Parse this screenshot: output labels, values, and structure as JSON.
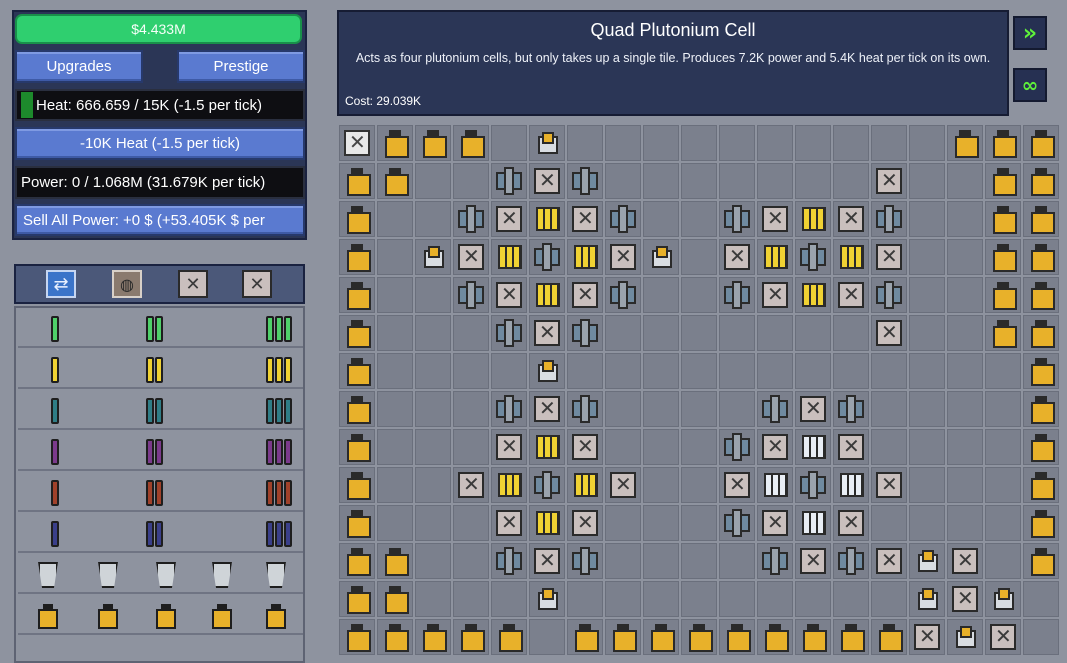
{
  "money": "$4.433M",
  "buttons": {
    "upgrades": "Upgrades",
    "prestige": "Prestige",
    "vent_heat": "-10K Heat (-1.5 per tick)",
    "sell_power": "Sell All Power: +0 $ (+53.405K $ per"
  },
  "heat": "Heat: 666.659 / 15K (-1.5 per tick)",
  "power": "Power: 0 / 1.068M (31.679K per tick)",
  "info": {
    "title": "Quad Plutonium Cell",
    "description": "Acts as four plutonium cells, but only takes up a single tile. Produces 7.2K power and 5.4K heat per tick on its own.",
    "cost": "Cost: 29.039K"
  },
  "part_tabs": [
    "power-tab-icon",
    "heat-tab-icon",
    "locked-tab-icon",
    "locked-tab-icon"
  ],
  "part_rows": [
    {
      "color": "#4fd06a",
      "kinds": [
        "single",
        "double",
        "quad"
      ]
    },
    {
      "color": "#f0d233",
      "kinds": [
        "single",
        "double",
        "quad"
      ]
    },
    {
      "color": "#2f7d86",
      "kinds": [
        "single",
        "double",
        "quad"
      ]
    },
    {
      "color": "#7b3a8c",
      "kinds": [
        "single",
        "double",
        "quad"
      ]
    },
    {
      "color": "#a0412a",
      "kinds": [
        "single",
        "double",
        "quad"
      ]
    },
    {
      "color": "#3a3f8a",
      "kinds": [
        "single",
        "double",
        "quad"
      ]
    },
    {
      "color": "#cfd4d8",
      "kinds": [
        "reflector",
        "reflector",
        "reflector",
        "reflector",
        "reflector"
      ]
    },
    {
      "color": "#e8b12a",
      "kinds": [
        "capacitor",
        "capacitor",
        "capacitor",
        "capacitor",
        "capacitor"
      ]
    }
  ],
  "reactor_grid": [
    "S C C C . p . . . . . . . . . . C C C",
    "C C . . x v x . . . . . . . v . . C C",
    "C . . x v q v x . . x v q v x . . C C",
    "C . p v q e q v p . v q e q v . . C C",
    "C . . x v q v x . . x v q v x . . C C",
    "C . . . x v x . . . . . . . v . . C C",
    "C . . . . p . . . . . . . . . . . . C",
    "C . . . x v x . . . . x v x . . . . C",
    "C . . . v q v . . . x v w v . . . . C",
    "C . . v q e q v . . v w e w v . . . C",
    "C . . . v q v . . . x v w v . . . . C",
    "C C . . x v x . . . . x v x v p v . C",
    "C C . . . p . . . . . . . . . p v p .",
    "C C C C C . C C C C C C C C C v p v ."
  ]
}
